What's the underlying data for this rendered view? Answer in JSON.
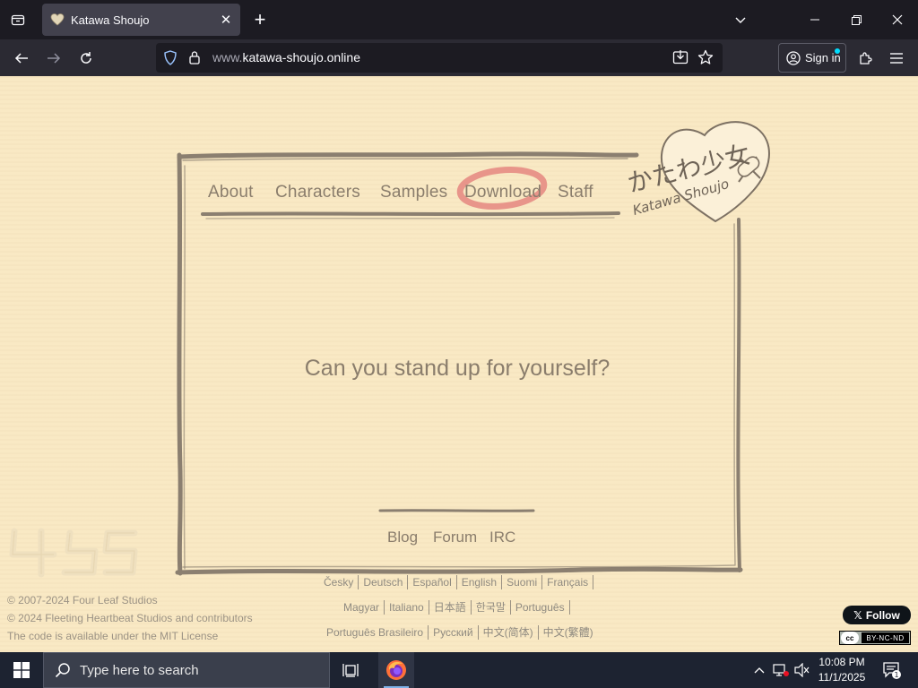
{
  "browser": {
    "tab": {
      "title": "Katawa Shoujo"
    },
    "url": {
      "prefix": "www.",
      "domain": "katawa-shoujo.online"
    },
    "signin_label": "Sign in"
  },
  "site": {
    "menu": [
      "About",
      "Characters",
      "Samples",
      "Download",
      "Staff"
    ],
    "logo_japanese": "かたわ少女",
    "logo_romaji": "Katawa Shoujo",
    "tagline": "Can you stand up for yourself?",
    "footer_links": [
      "Blog",
      "Forum",
      "IRC"
    ],
    "copyright": [
      "© 2007-2024 Four Leaf Studios",
      "© 2024 Fleeting Heartbeat Studios and contributors",
      "The code is available under the MIT License"
    ],
    "languages_row1": [
      "Česky",
      "Deutsch",
      "Español",
      "English",
      "Suomi",
      "Français"
    ],
    "languages_row2": [
      "Magyar",
      "Italiano",
      "日本語",
      "한국말",
      "Português"
    ],
    "languages_row3": [
      "Português Brasileiro",
      "Русский",
      "中文(简体)",
      "中文(繁體)"
    ],
    "follow_label": "Follow",
    "cc_label": "BY-NC-ND",
    "cc_mark": "cc"
  },
  "taskbar": {
    "search_placeholder": "Type here to search",
    "time": "10:08 PM",
    "date": "11/1/2025",
    "notification_count": "1"
  },
  "colors": {
    "page_bg": "#f9e8c2",
    "ink": "#8a7d6c",
    "download_highlight": "#e8958a"
  }
}
